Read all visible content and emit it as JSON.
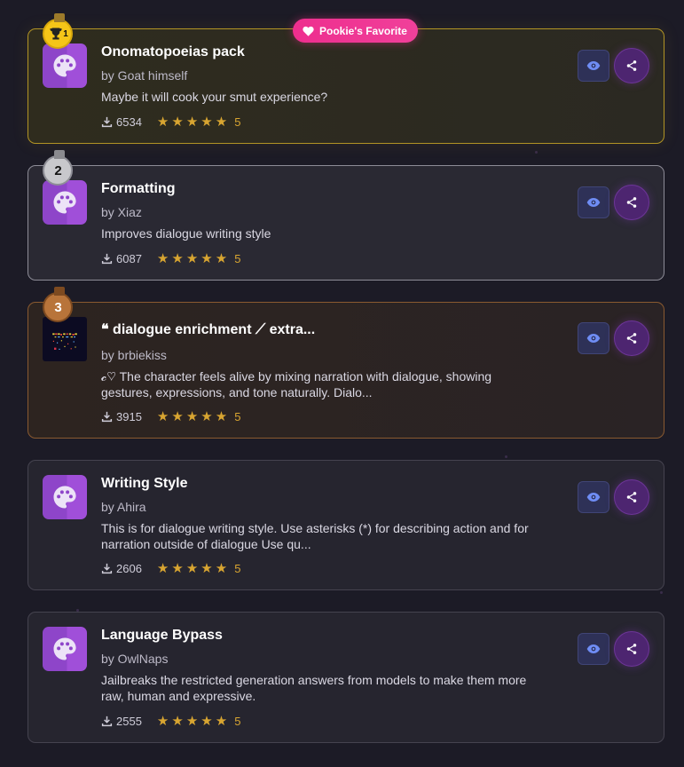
{
  "favorite_badge": {
    "label": "Pookie's Favorite",
    "icon": "heart-icon"
  },
  "cards": [
    {
      "rank": "1",
      "title": "Onomatopoeias pack",
      "author": "by Goat himself",
      "description": "Maybe it will cook your smut experience?",
      "downloads": "6534",
      "rating": "5"
    },
    {
      "rank": "2",
      "title": "Formatting",
      "author": "by Xiaz",
      "description": "Improves dialogue writing style",
      "downloads": "6087",
      "rating": "5"
    },
    {
      "rank": "3",
      "title": "❝ dialogue enrichment ⟋ extra...",
      "author": "by brbiekiss",
      "description": "𝓬♡ The character feels alive by mixing narration with dialogue, showing gestures, expressions, and tone naturally. Dialo...",
      "downloads": "3915",
      "rating": "5"
    },
    {
      "title": "Writing Style",
      "author": "by Ahira",
      "description": "This is for dialogue writing style. Use asterisks (*) for describing action and for narration outside of dialogue Use qu...",
      "downloads": "2606",
      "rating": "5"
    },
    {
      "title": "Language Bypass",
      "author": "by OwlNaps",
      "description": "Jailbreaks the restricted generation answers from models to make them more raw, human and expressive.",
      "downloads": "2555",
      "rating": "5"
    }
  ],
  "colors": {
    "background": "#1c1b26",
    "gold": "#f5c518",
    "silver": "#c8c8cc",
    "bronze": "#b8743a",
    "star": "#d8a531",
    "favorite": "#ee2e8e"
  }
}
